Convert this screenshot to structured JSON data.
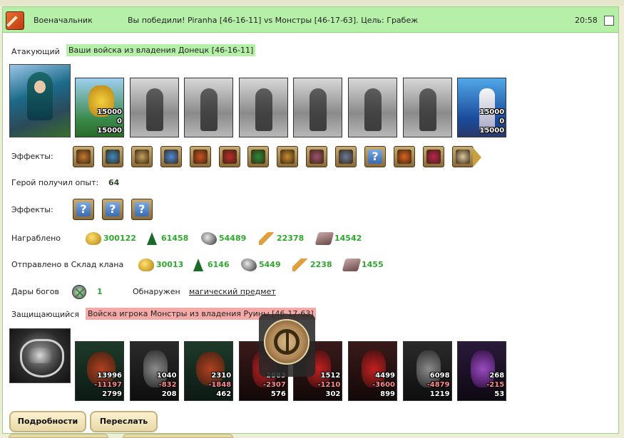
{
  "header": {
    "title": "Военачальник",
    "message": "Вы победили! Piranha [46-16-11] vs Монстры [46-17-63]. Цель: Грабеж",
    "time": "20:58"
  },
  "attacker": {
    "label": "Атакующий",
    "tag": "Ваши войска из владения Донецк [46-16-11]",
    "units": [
      {
        "type": "colored-a",
        "count": "15000",
        "loss": "0",
        "remain": "15000"
      },
      {
        "type": "gray"
      },
      {
        "type": "gray"
      },
      {
        "type": "gray"
      },
      {
        "type": "gray"
      },
      {
        "type": "gray"
      },
      {
        "type": "gray"
      },
      {
        "type": "colored-b",
        "count": "15000",
        "loss": "0",
        "remain": "15000"
      }
    ]
  },
  "effects1": {
    "label": "Эффекты:",
    "icons": [
      "bag-icon",
      "sword-icon",
      "handshake-icon",
      "magic-hand-icon",
      "fire-icon",
      "dice-icon",
      "shield-icon",
      "hand-shield-icon",
      "temple-icon",
      "web-icon",
      "question-icon",
      "fire-crest-icon",
      "broken-shield-icon",
      "shell-icon"
    ],
    "colors": [
      "#c87830",
      "#3a8ac8",
      "#c8a060",
      "#4a8ae0",
      "#d05020",
      "#c02a2a",
      "#2a8a3a",
      "#c88a30",
      "#a05070",
      "#6a7aa0",
      "#3a6ab0",
      "#e06020",
      "#c02050",
      "#d8c8a0"
    ]
  },
  "experience": {
    "label": "Герой получил опыт:",
    "value": "64"
  },
  "effects2": {
    "label": "Эффекты:",
    "count": 3
  },
  "loot": {
    "label": "Награблено",
    "values": [
      "300122",
      "61458",
      "54489",
      "22378",
      "14542"
    ]
  },
  "sent": {
    "label": "Отправлено в Склад клана",
    "values": [
      "30013",
      "6146",
      "5449",
      "2238",
      "1455"
    ]
  },
  "gifts": {
    "label": "Дары богов",
    "value": "1",
    "found_label": "Обнаружен",
    "found_link": "магический предмет"
  },
  "defender": {
    "label": "Защищающийся",
    "tag": "Войска игрока Монстры из владения Руины [46-17-63]",
    "units": [
      {
        "type": "dark-green",
        "count": "13996",
        "loss": "-11197",
        "remain": "2799"
      },
      {
        "type": "dark-gray",
        "count": "1040",
        "loss": "-832",
        "remain": "208"
      },
      {
        "type": "dark-green",
        "count": "2310",
        "loss": "-1848",
        "remain": "462"
      },
      {
        "type": "dark-red",
        "count": "2883",
        "loss": "-2307",
        "remain": "576"
      },
      {
        "type": "dark-red",
        "count": "1512",
        "loss": "-1210",
        "remain": "302"
      },
      {
        "type": "dark-red",
        "count": "4499",
        "loss": "-3600",
        "remain": "899"
      },
      {
        "type": "dark-gray",
        "count": "6098",
        "loss": "-4879",
        "remain": "1219"
      },
      {
        "type": "dark-purple",
        "count": "268",
        "loss": "-215",
        "remain": "53"
      }
    ]
  },
  "buttons": {
    "details": "Подробности",
    "forward": "Переслать"
  }
}
